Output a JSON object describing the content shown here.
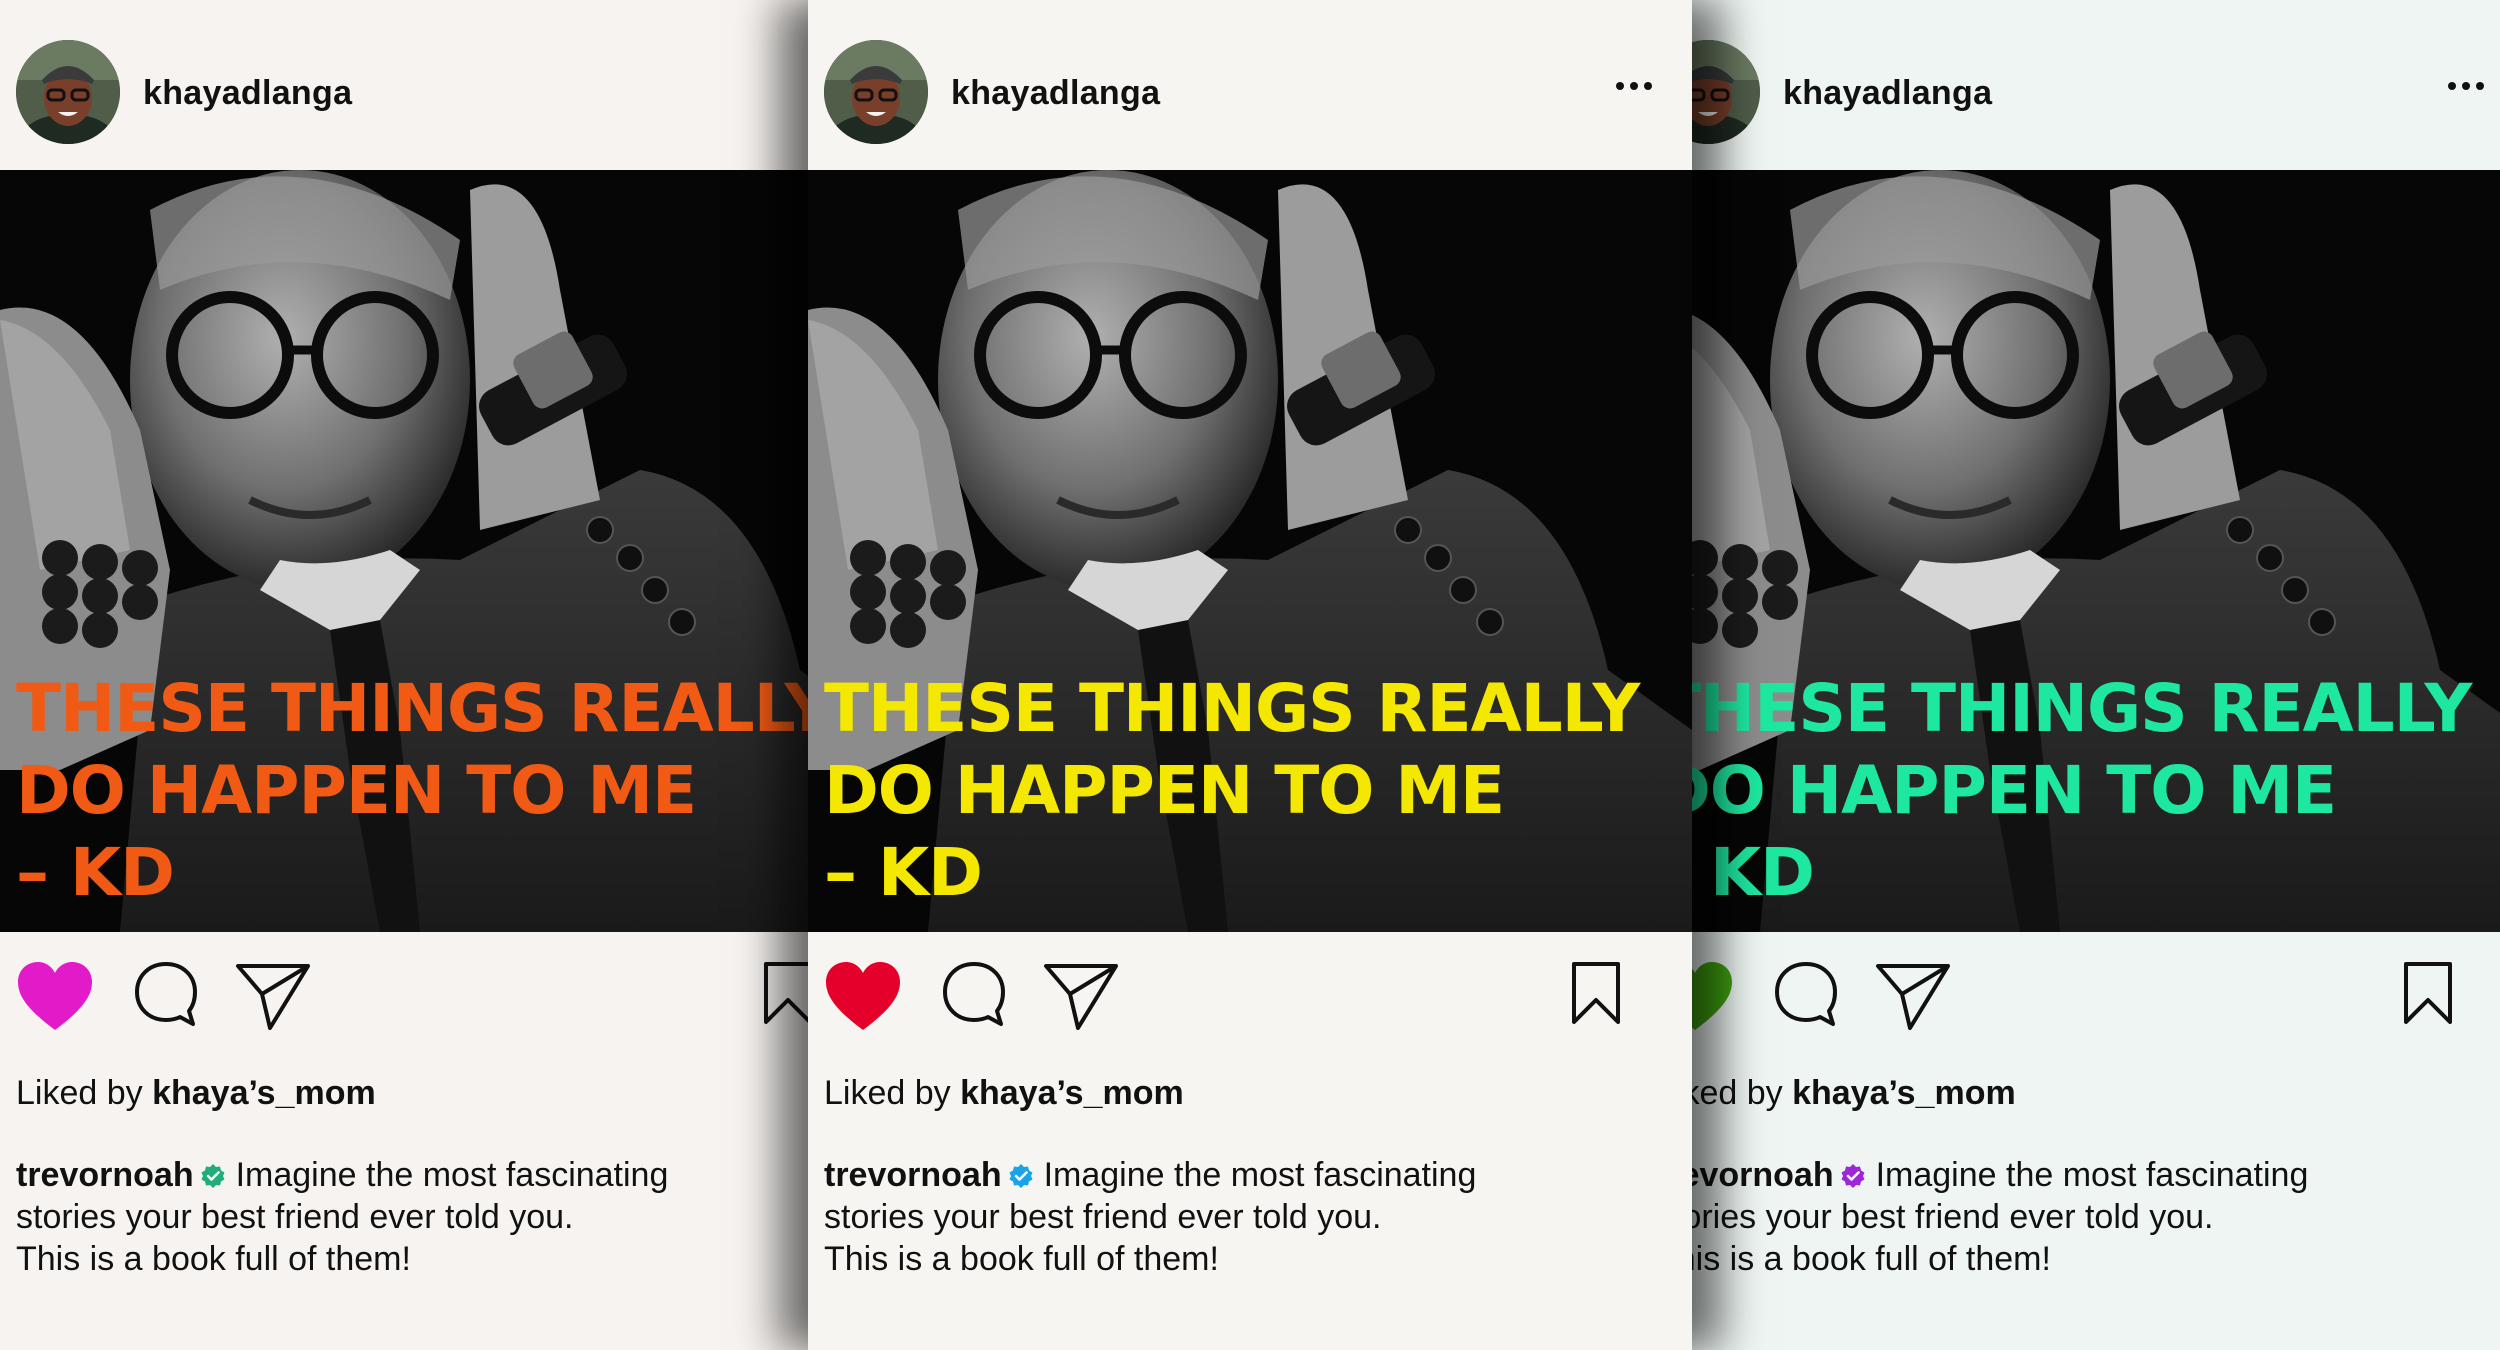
{
  "posts": [
    {
      "username": "khayadlanga",
      "quote_lines": [
        "THESE THINGS REALLY",
        "DO HAPPEN TO ME",
        "– KD"
      ],
      "quote_color": "#f15a14",
      "heart_color": "#e21bc8",
      "verified_color": "#1fae7a",
      "liked_by_prefix": "Liked by",
      "liked_by_user": "khaya’s_mom",
      "caption_user": "trevornoah",
      "caption_lines": [
        "Imagine the most fascinating",
        "stories your best friend ever told you.",
        "This is a book full of them!"
      ]
    },
    {
      "username": "khayadlanga",
      "quote_lines": [
        "THESE THINGS REALLY",
        "DO HAPPEN TO ME",
        "– KD"
      ],
      "quote_color": "#f5e800",
      "heart_color": "#e4002b",
      "verified_color": "#1aa4e8",
      "liked_by_prefix": "Liked by",
      "liked_by_user": "khaya’s_mom",
      "caption_user": "trevornoah",
      "caption_lines": [
        "Imagine the most fascinating",
        "stories your best friend ever told you.",
        "This is a book full of them!"
      ]
    },
    {
      "username": "khayadlanga",
      "quote_lines": [
        "THESE THINGS REALLY",
        "DO HAPPEN TO ME",
        "– KD"
      ],
      "quote_color": "#1ee8a0",
      "heart_color": "#3fa012",
      "verified_color": "#9b27d8",
      "liked_by_prefix": "Liked by",
      "liked_by_user": "khaya’s_mom",
      "caption_user": "trevornoah",
      "caption_lines": [
        "Imagine the most fascinating",
        "stories your best friend ever told you.",
        "This is a book full of them!"
      ]
    }
  ],
  "icons": {
    "more": "more-dots-icon",
    "heart": "heart-icon",
    "comment": "comment-icon",
    "send": "send-icon",
    "bookmark": "bookmark-icon",
    "verified": "verified-badge-icon"
  }
}
